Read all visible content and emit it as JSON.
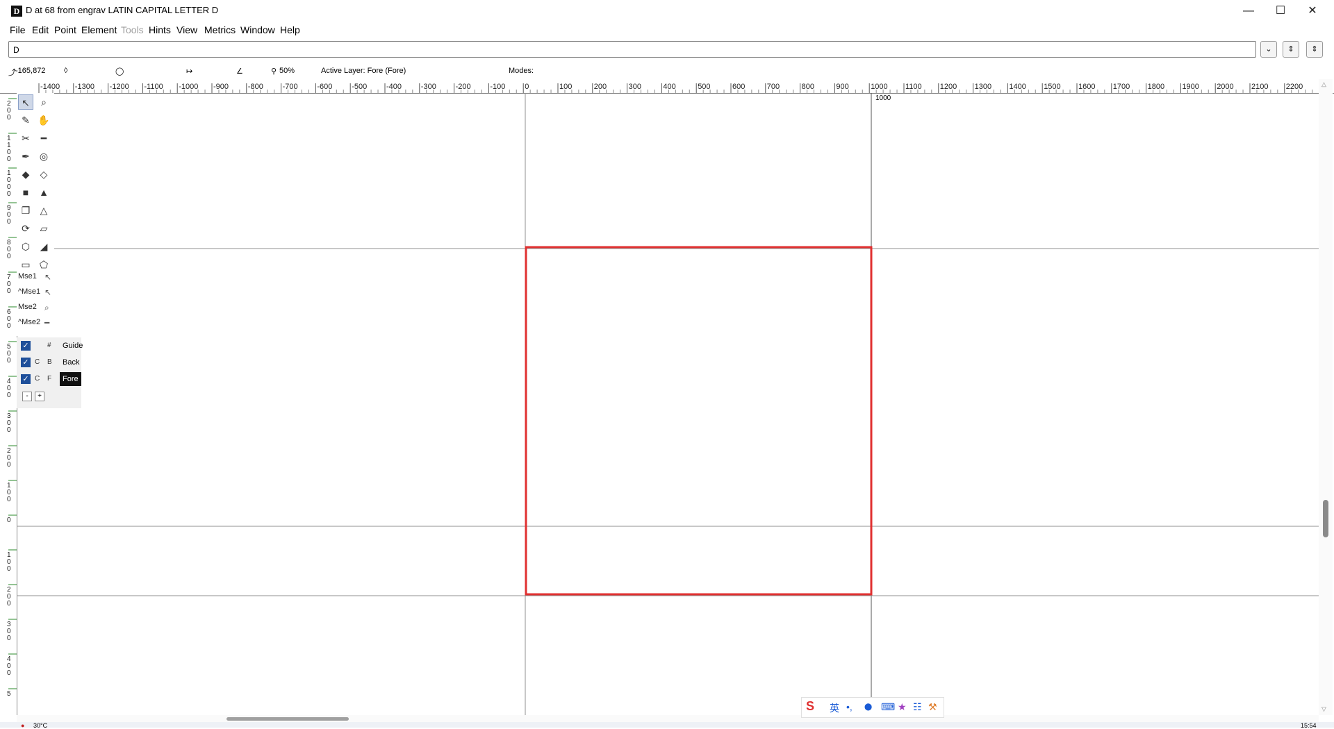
{
  "window": {
    "title": "D at 68 from engrav LATIN CAPITAL LETTER D",
    "app_icon": "D",
    "minimize_glyph": "—",
    "maximize_glyph": "☐",
    "close_glyph": "✕"
  },
  "menu": [
    {
      "label": "File",
      "enabled": true
    },
    {
      "label": "Edit",
      "enabled": true
    },
    {
      "label": "Point",
      "enabled": true
    },
    {
      "label": "Element",
      "enabled": true
    },
    {
      "label": "Tools",
      "enabled": false
    },
    {
      "label": "Hints",
      "enabled": true
    },
    {
      "label": "View",
      "enabled": true
    },
    {
      "label": "Metrics",
      "enabled": true
    },
    {
      "label": "Window",
      "enabled": true
    },
    {
      "label": "Help",
      "enabled": true
    }
  ],
  "glyph_field": {
    "value": "D"
  },
  "infobar": {
    "coords": "-165,872",
    "zoom": "50%",
    "active_layer": "Active Layer: Fore (Fore)",
    "modes": "Modes:"
  },
  "ruler": {
    "h_labels": [
      "-1400",
      "-1300",
      "-1200",
      "-1100",
      "-1000",
      "-900",
      "-800",
      "-700",
      "-600",
      "-500",
      "-400",
      "-300",
      "-200",
      "-100",
      "0",
      "100",
      "200",
      "300",
      "400",
      "500",
      "600",
      "700",
      "800",
      "900",
      "1000",
      "1100",
      "1200",
      "1300",
      "1400",
      "1500",
      "1600",
      "1700",
      "1800",
      "1900",
      "2000",
      "2100",
      "2200"
    ],
    "v_labels": [
      "2 0 0",
      "1 1 0 0",
      "1 0 0 0",
      "9 0 0",
      "8 0 0",
      "7 0 0",
      "6 0 0",
      "5 0 0",
      "4 0 0",
      "3 0 0",
      "2 0 0",
      "1 0 0",
      "0",
      "1 0 0",
      "2 0 0",
      "3 0 0",
      "4 0 0",
      "5"
    ]
  },
  "canvas": {
    "advance_width_label": "1000",
    "glyph_box_color": "#e03030",
    "guide_line_color": "#909090"
  },
  "toolbox": {
    "tools": [
      {
        "name": "pointer-icon",
        "glyph": "↖"
      },
      {
        "name": "magnify-icon",
        "glyph": "⌕"
      },
      {
        "name": "freehand-pencil-icon",
        "glyph": "✎"
      },
      {
        "name": "scroll-hand-icon",
        "glyph": "✋"
      },
      {
        "name": "knife-icon",
        "glyph": "✂"
      },
      {
        "name": "ruler-icon",
        "glyph": "━"
      },
      {
        "name": "pen-icon",
        "glyph": "✒"
      },
      {
        "name": "spiro-icon",
        "glyph": "◎"
      },
      {
        "name": "curve-point-icon",
        "glyph": "◆"
      },
      {
        "name": "hv-curve-point-icon",
        "glyph": "◇"
      },
      {
        "name": "corner-point-icon",
        "glyph": "■"
      },
      {
        "name": "tangent-point-icon",
        "glyph": "▲"
      },
      {
        "name": "scale-icon",
        "glyph": "❐"
      },
      {
        "name": "flip-icon",
        "glyph": "△"
      },
      {
        "name": "rotate-icon",
        "glyph": "⟳"
      },
      {
        "name": "skew-icon",
        "glyph": "▱"
      },
      {
        "name": "3d-rotate-icon",
        "glyph": "⬡"
      },
      {
        "name": "perspective-icon",
        "glyph": "◢"
      },
      {
        "name": "rectangle-icon",
        "glyph": "▭"
      },
      {
        "name": "polygon-icon",
        "glyph": "⬠"
      }
    ],
    "mouse": [
      {
        "label": "Mse1",
        "glyph": "↖"
      },
      {
        "label": "^Mse1",
        "glyph": "↖"
      },
      {
        "label": "Mse2",
        "glyph": "⌕"
      },
      {
        "label": "^Mse2",
        "glyph": "━"
      }
    ]
  },
  "layers": [
    {
      "visible": true,
      "flag1": "",
      "flag2": "#",
      "name": "Guide",
      "active": false
    },
    {
      "visible": true,
      "flag1": "C",
      "flag2": "B",
      "name": "Back",
      "active": false
    },
    {
      "visible": true,
      "flag1": "C",
      "flag2": "F",
      "name": "Fore",
      "active": true
    }
  ],
  "layer_buttons": {
    "remove": "-",
    "add": "+"
  },
  "ime": {
    "logo": "S",
    "lang": "英",
    "punct": "•,",
    "mic": "⬤",
    "keyboard": "⌨",
    "skin": "★",
    "apps": "☷",
    "tools": "⚒"
  },
  "taskbar": {
    "weather": "30°C",
    "time": "15:54"
  }
}
